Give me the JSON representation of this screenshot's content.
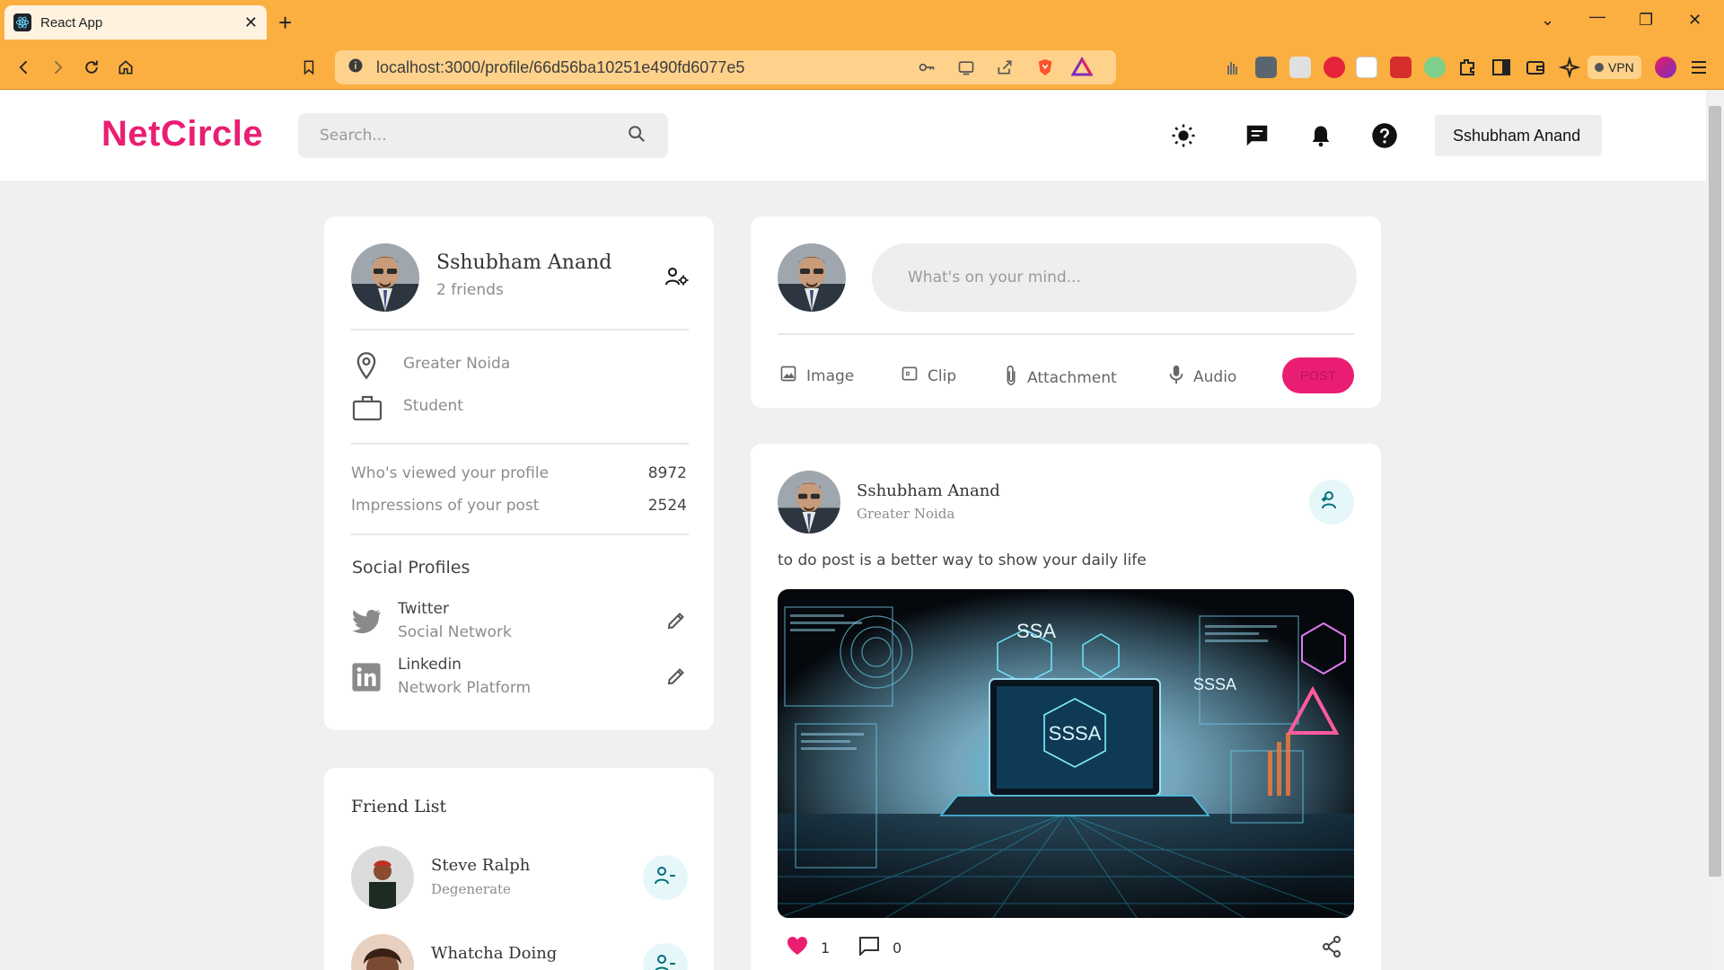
{
  "browser": {
    "tab_title": "React App",
    "url": "localhost:3000/profile/66d56ba10251e490fd6077e5",
    "vpn_label": "VPN"
  },
  "app": {
    "logo": "NetCircle",
    "search_placeholder": "Search...",
    "user_menu": "Sshubham Anand",
    "accent": "#e91e73"
  },
  "profile": {
    "name": "Sshubham Anand",
    "friends": "2 friends",
    "location": "Greater Noida",
    "occupation": "Student",
    "stats": [
      {
        "label": "Who's viewed your profile",
        "value": "8972"
      },
      {
        "label": "Impressions of your post",
        "value": "2524"
      }
    ],
    "social_title": "Social Profiles",
    "socials": [
      {
        "name": "Twitter",
        "type": "Social Network",
        "icon": "twitter-icon"
      },
      {
        "name": "Linkedin",
        "type": "Network Platform",
        "icon": "linkedin-icon"
      }
    ]
  },
  "friend_list": {
    "title": "Friend List",
    "items": [
      {
        "name": "Steve Ralph",
        "subtitle": "Degenerate"
      },
      {
        "name": "Whatcha Doing",
        "subtitle": ""
      }
    ]
  },
  "composer": {
    "placeholder": "What's on your mind...",
    "tools": [
      "Image",
      "Clip",
      "Attachment",
      "Audio"
    ],
    "post_label": "POST"
  },
  "post": {
    "author": "Sshubham Anand",
    "location": "Greater Noida",
    "text": "to do post is a better way to show your daily life",
    "likes": "1",
    "comments": "0",
    "image_texts": {
      "center": "SSSA",
      "top": "SSA",
      "right": "SSSA"
    }
  }
}
